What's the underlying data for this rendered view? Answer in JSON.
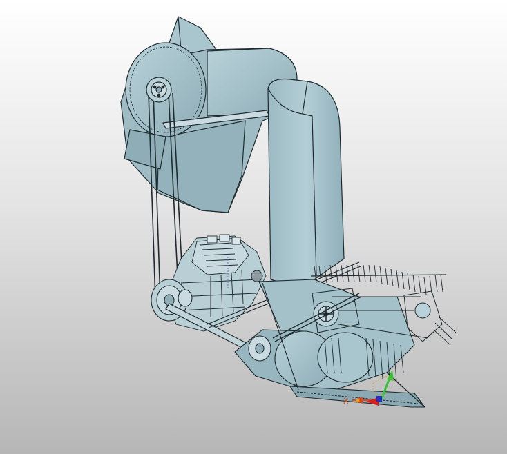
{
  "viewport": {
    "background_top": "#ffffff",
    "background_bottom": "#b6b6b6"
  },
  "model": {
    "part_color": "#a8c4cc",
    "part_shadow": "#8aa9b3",
    "edge_color": "#1f2a2e"
  },
  "triad": {
    "x_label": "X",
    "x_color": "#d64a1e",
    "y_color": "#36c236",
    "z_color": "#2230c8",
    "origin_color": "#e0a020"
  },
  "icons": [
    "reel-icon",
    "pulley-icon",
    "engine-icon",
    "axis-triad-icon"
  ]
}
